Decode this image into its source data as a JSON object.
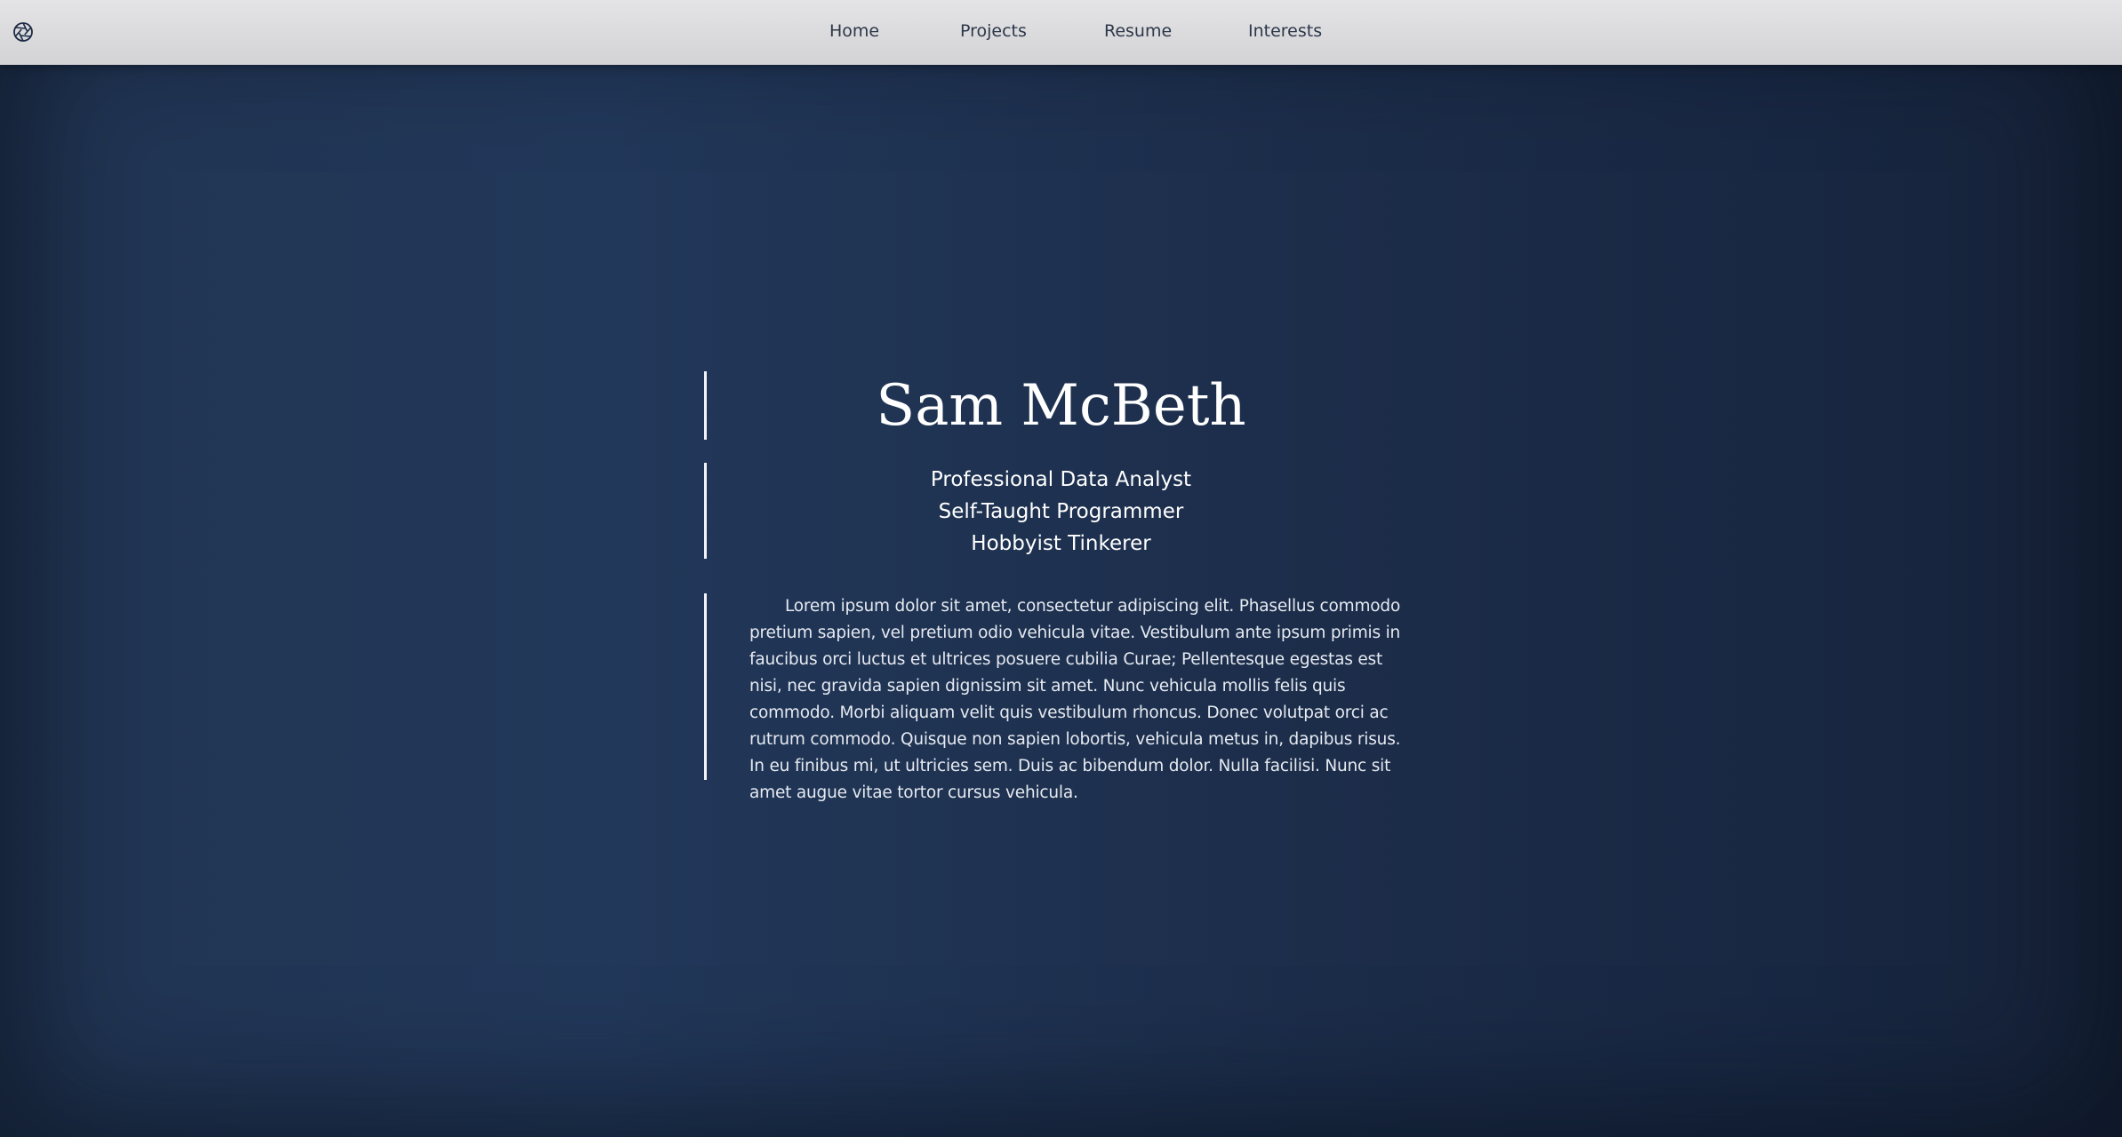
{
  "nav": {
    "logo_icon": "aperture-icon",
    "links": [
      {
        "label": "Home"
      },
      {
        "label": "Projects"
      },
      {
        "label": "Resume"
      },
      {
        "label": "Interests"
      }
    ]
  },
  "hero": {
    "name": "Sam McBeth",
    "roles": [
      "Professional Data Analyst",
      "Self-Taught Programmer",
      "Hobbyist Tinkerer"
    ],
    "bio": "Lorem ipsum dolor sit amet, consectetur adipiscing elit. Phasellus commodo pretium sapien, vel pretium odio vehicula vitae. Vestibulum ante ipsum primis in faucibus orci luctus et ultrices posuere cubilia Curae; Pellentesque egestas est nisi, nec gravida sapien dignissim sit amet. Nunc vehicula mollis felis quis commodo. Morbi aliquam velit quis vestibulum rhoncus. Donec volutpat orci ac rutrum commodo. Quisque non sapien lobortis, vehicula metus in, dapibus risus. In eu finibus mi, ut ultricies sem. Duis ac bibendum dolor. Nulla facilisi. Nunc sit amet augue vitae tortor cursus vehicula."
  },
  "colors": {
    "navbar": "#d9d9dc",
    "background": "#1f3150",
    "text": "#ffffff",
    "nav_text": "#2c3748"
  }
}
